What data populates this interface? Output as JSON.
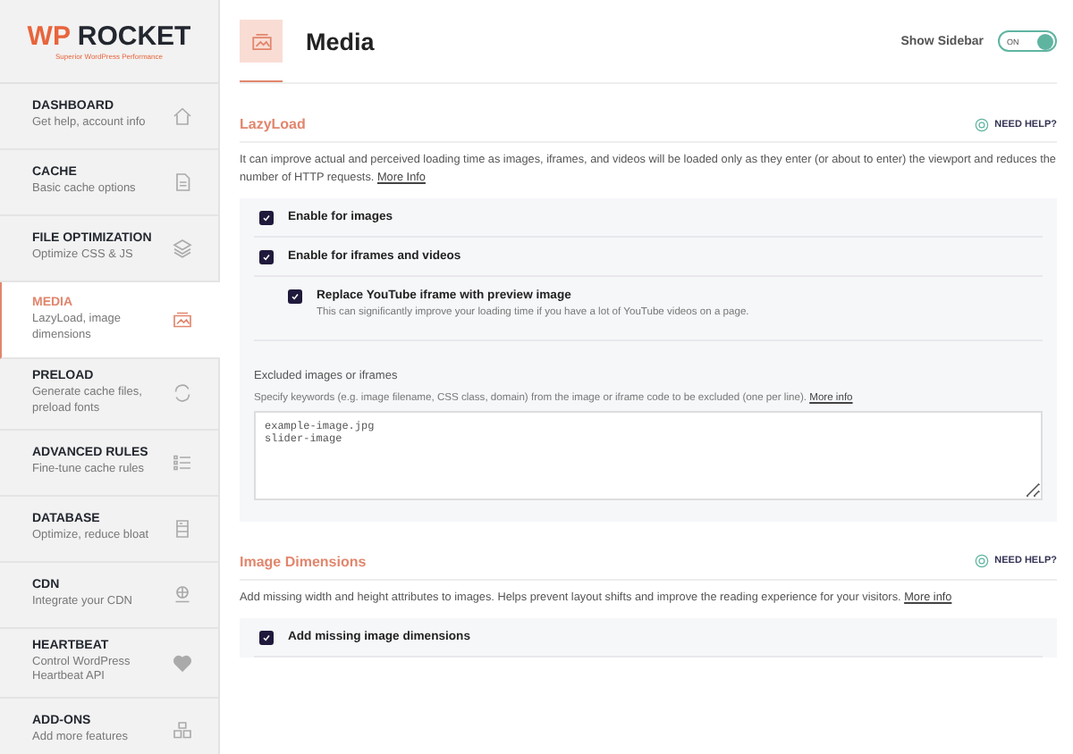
{
  "logo": {
    "prefix": "WP",
    "name": "ROCKET",
    "tagline": "Superior WordPress Performance"
  },
  "nav": [
    {
      "title": "DASHBOARD",
      "subtitle": "Get help, account info",
      "kind": "home",
      "selected": false
    },
    {
      "title": "CACHE",
      "subtitle": "Basic cache options",
      "kind": "file",
      "selected": false
    },
    {
      "title": "FILE OPTIMIZATION",
      "subtitle": "Optimize CSS & JS",
      "kind": "layers",
      "selected": false
    },
    {
      "title": "MEDIA",
      "subtitle": "LazyLoad, image dimensions",
      "kind": "media",
      "selected": true
    },
    {
      "title": "PRELOAD",
      "subtitle": "Generate cache files, preload fonts",
      "kind": "refresh",
      "selected": false
    },
    {
      "title": "ADVANCED RULES",
      "subtitle": "Fine-tune cache rules",
      "kind": "list",
      "selected": false
    },
    {
      "title": "DATABASE",
      "subtitle": "Optimize, reduce bloat",
      "kind": "database",
      "selected": false
    },
    {
      "title": "CDN",
      "subtitle": "Integrate your CDN",
      "kind": "cdn",
      "selected": false
    },
    {
      "title": "HEARTBEAT",
      "subtitle": "Control WordPress Heartbeat API",
      "kind": "heart",
      "selected": false
    },
    {
      "title": "ADD-ONS",
      "subtitle": "Add more features",
      "kind": "addons",
      "selected": false
    }
  ],
  "header": {
    "title": "Media",
    "sidebar_toggle": {
      "label": "Show Sidebar",
      "state": "ON",
      "on": true
    }
  },
  "sections": [
    {
      "title": "LazyLoad",
      "help": "NEED HELP?",
      "description": "It can improve actual and perceived loading time as images, iframes, and videos will be loaded only as they enter (or about to enter) the viewport and reduces the number of HTTP requests.",
      "link": "More Info",
      "options": [
        {
          "label": "Enable for images",
          "checked": true
        },
        {
          "label": "Enable for iframes and videos",
          "checked": true,
          "children": [
            {
              "label": "Replace YouTube iframe with preview image",
              "hint": "This can significantly improve your loading time if you have a lot of YouTube videos on a page.",
              "checked": true
            }
          ]
        }
      ],
      "field": {
        "label": "Excluded images or iframes",
        "hint": "Specify keywords (e.g. image filename, CSS class, domain) from the image or iframe code to be excluded (one per line).",
        "link": "More info",
        "value": "example-image.jpg\nslider-image"
      }
    },
    {
      "title": "Image Dimensions",
      "help": "NEED HELP?",
      "description": "Add missing width and height attributes to images. Helps prevent layout shifts and improve the reading experience for your visitors.",
      "link": "More info",
      "options": [
        {
          "label": "Add missing image dimensions",
          "checked": true
        }
      ]
    }
  ]
}
